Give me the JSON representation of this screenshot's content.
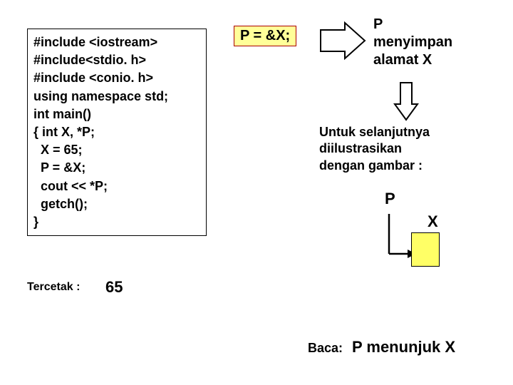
{
  "code": "#include <iostream>\n#include<stdio. h>\n#include <conio. h>\nusing namespace std;\nint main()\n{ int X, *P;\n  X = 65;\n  P = &X;\n  cout << *P;\n  getch();\n}",
  "highlight_expr": "P = &X;",
  "p_store_text": "P\nmenyimpan\nalamat X",
  "untuk_text": "Untuk selanjutnya\ndiilustrasikan\ndengan gambar :",
  "label_p": "P",
  "label_x": "X",
  "tercetak_label": "Tercetak :",
  "tercetak_value": "65",
  "baca_label": "Baca:",
  "baca_text": "P menunjuk X"
}
